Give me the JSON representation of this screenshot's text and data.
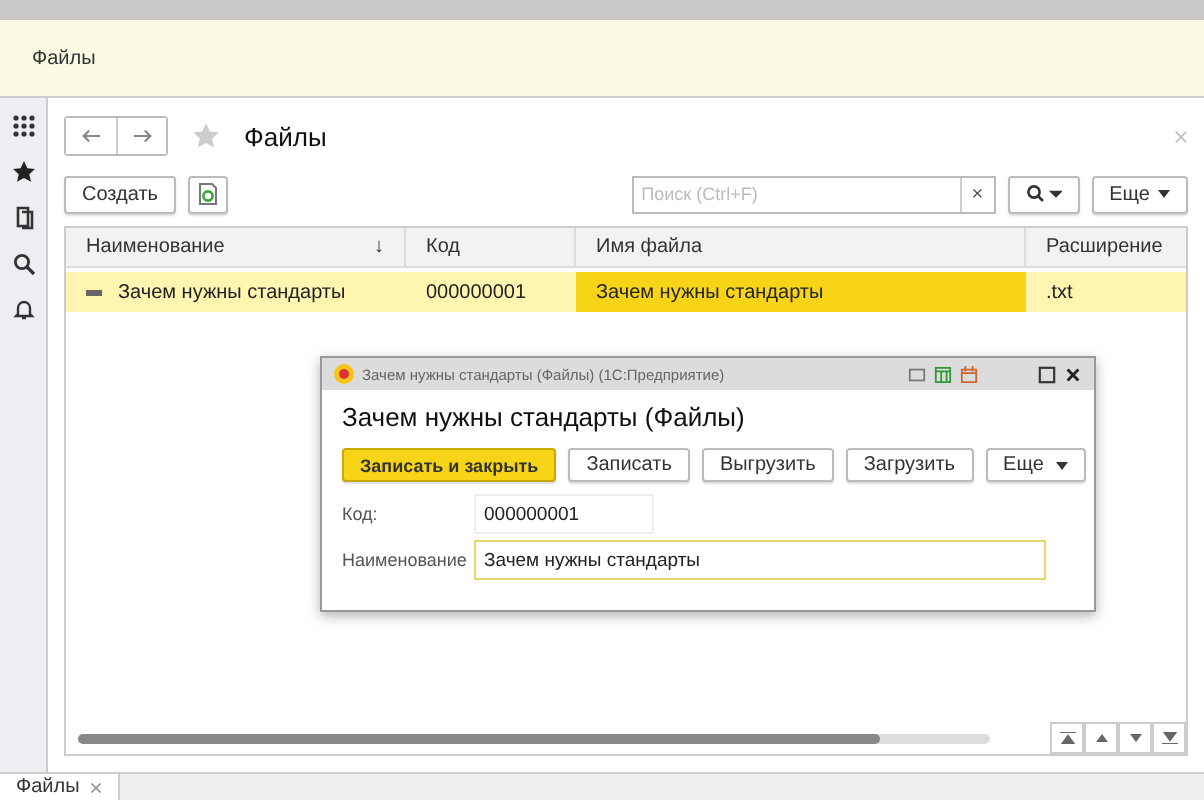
{
  "top_panel": {
    "section_title": "Файлы"
  },
  "form": {
    "title": "Файлы"
  },
  "toolbar": {
    "create": "Создать",
    "search_placeholder": "Поиск (Ctrl+F)",
    "clear": "×",
    "more": "Еще"
  },
  "table": {
    "columns": [
      {
        "label": "Наименование",
        "sort": "↓"
      },
      {
        "label": "Код"
      },
      {
        "label": "Имя файла"
      },
      {
        "label": "Расширение"
      }
    ],
    "rows": [
      {
        "selected": true,
        "cells": [
          {
            "text": "Зачем нужны стандарты",
            "focused": false
          },
          {
            "text": "000000001",
            "focused": false
          },
          {
            "text": "Зачем нужны стандарты",
            "focused": true
          },
          {
            "text": ".txt",
            "focused": false
          }
        ]
      }
    ]
  },
  "dialog": {
    "window_title": "Зачем нужны стандарты (Файлы) (1С:Предприятие)",
    "title": "Зачем нужны стандарты (Файлы)",
    "buttons": [
      {
        "label": "Записать и закрыть",
        "default": true,
        "menu": false
      },
      {
        "label": "Записать",
        "default": false,
        "menu": false
      },
      {
        "label": "Выгрузить",
        "default": false,
        "menu": false
      },
      {
        "label": "Загрузить",
        "default": false,
        "menu": false
      },
      {
        "label": "Еще",
        "default": false,
        "menu": true
      }
    ],
    "fields": [
      {
        "label": "Код:",
        "value": "000000001",
        "focused": false,
        "wide": false
      },
      {
        "label": "Наименование",
        "value": "Зачем нужны стандарты",
        "focused": true,
        "wide": true
      }
    ]
  },
  "tabs": [
    {
      "label": "Файлы",
      "selected": true
    }
  ]
}
